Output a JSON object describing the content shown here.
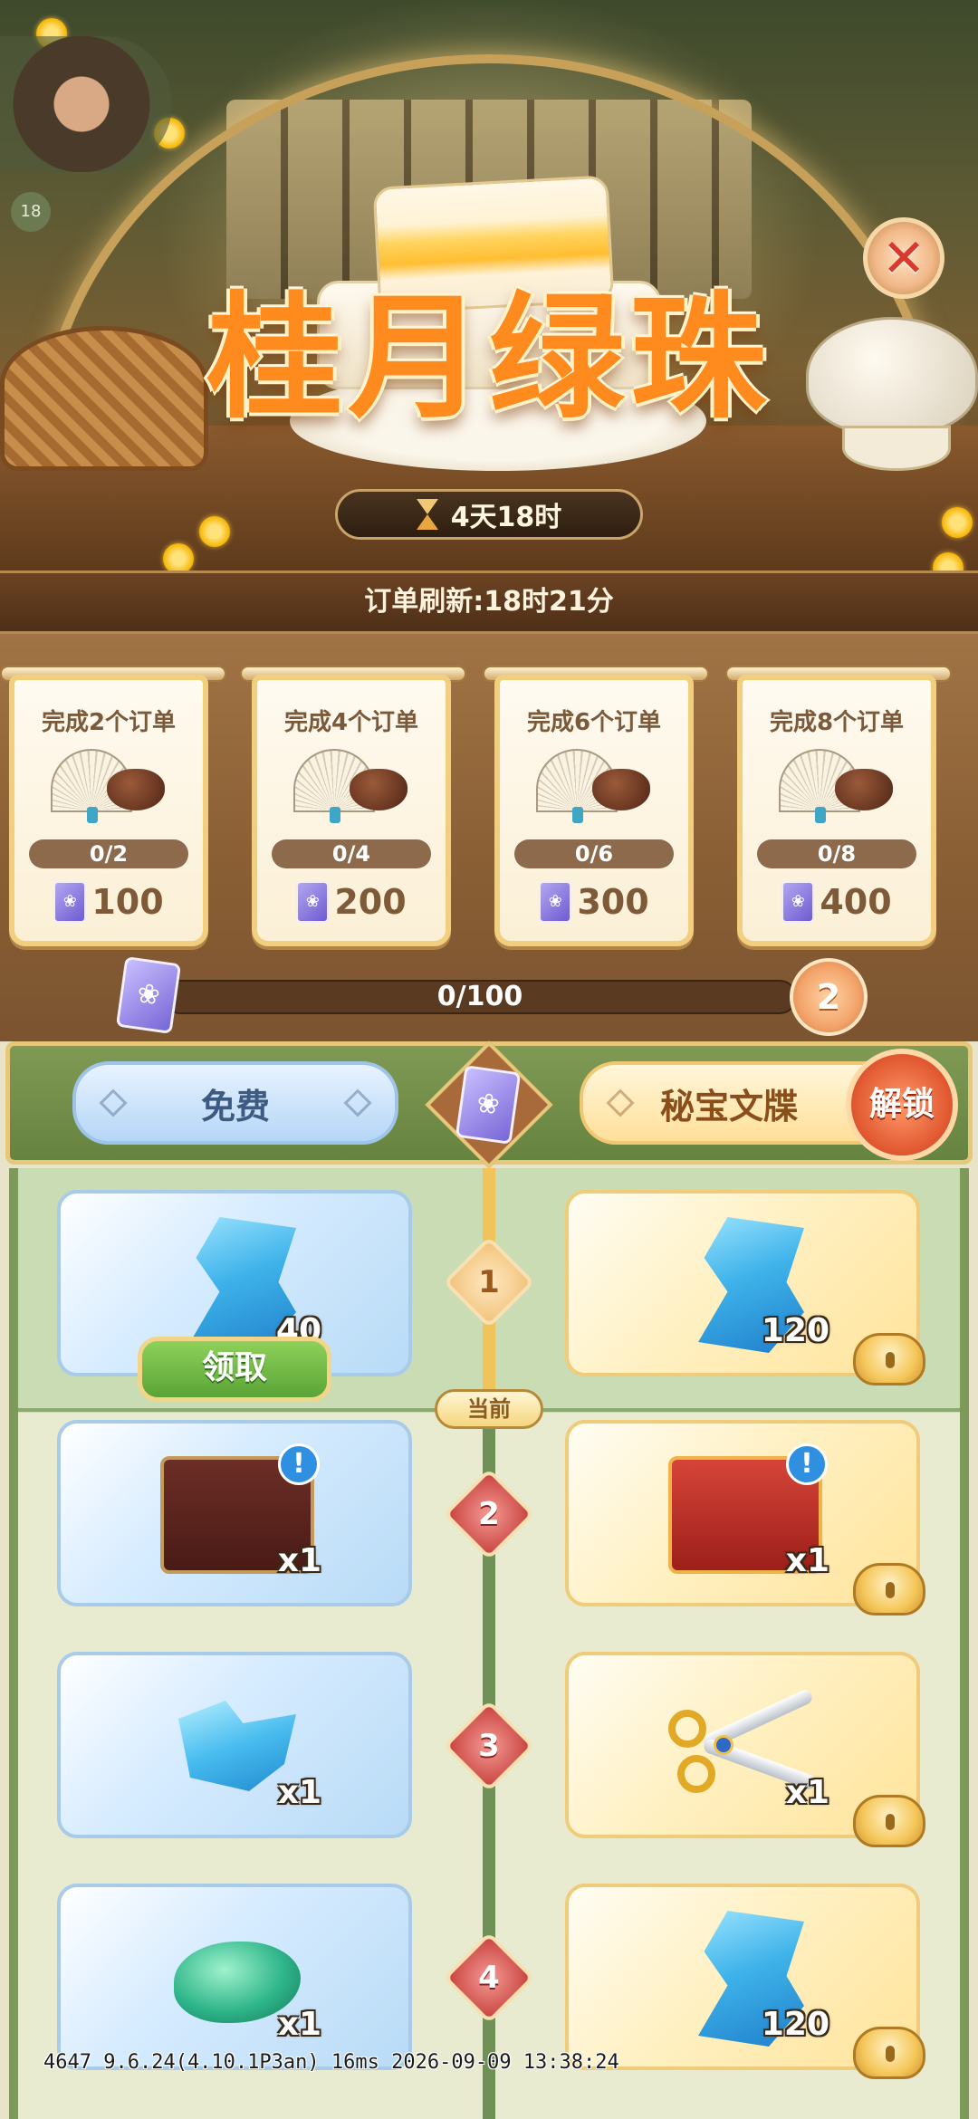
{
  "banner": {
    "title": "桂月绿珠",
    "timer": "4天18时",
    "avatar_level": "18",
    "close_icon": "close-icon"
  },
  "refresh": {
    "text": "订单刷新:18时21分"
  },
  "tasks": [
    {
      "label": "完成2个订单",
      "progress": "0/2",
      "reward": "100"
    },
    {
      "label": "完成4个订单",
      "progress": "0/4",
      "reward": "200"
    },
    {
      "label": "完成6个订单",
      "progress": "0/6",
      "reward": "300"
    },
    {
      "label": "完成8个订单",
      "progress": "0/8",
      "reward": "400"
    }
  ],
  "main_progress": {
    "value": "0/100",
    "level": "2"
  },
  "track": {
    "free_label": "免费",
    "premium_label": "秘宝文牒",
    "unlock_label": "解锁",
    "current_label": "当前",
    "claim_label": "领取"
  },
  "levels": [
    {
      "num": "1",
      "free": {
        "item": "blue-leaf",
        "qty": "40"
      },
      "premium": {
        "item": "blue-leaf",
        "qty": "120"
      }
    },
    {
      "num": "2",
      "free": {
        "item": "gift-box-dark",
        "qty": "x1"
      },
      "premium": {
        "item": "gift-box-red",
        "qty": "x1"
      }
    },
    {
      "num": "3",
      "free": {
        "item": "blue-double",
        "qty": "x1"
      },
      "premium": {
        "item": "scissors",
        "qty": "x1"
      }
    },
    {
      "num": "4",
      "free": {
        "item": "green-jade",
        "qty": "x1"
      },
      "premium": {
        "item": "blue-leaf",
        "qty": "120"
      }
    }
  ],
  "debug": "4647 9.6.24(4.10.1P3an) 16ms 2026-09-09 13:38:24"
}
